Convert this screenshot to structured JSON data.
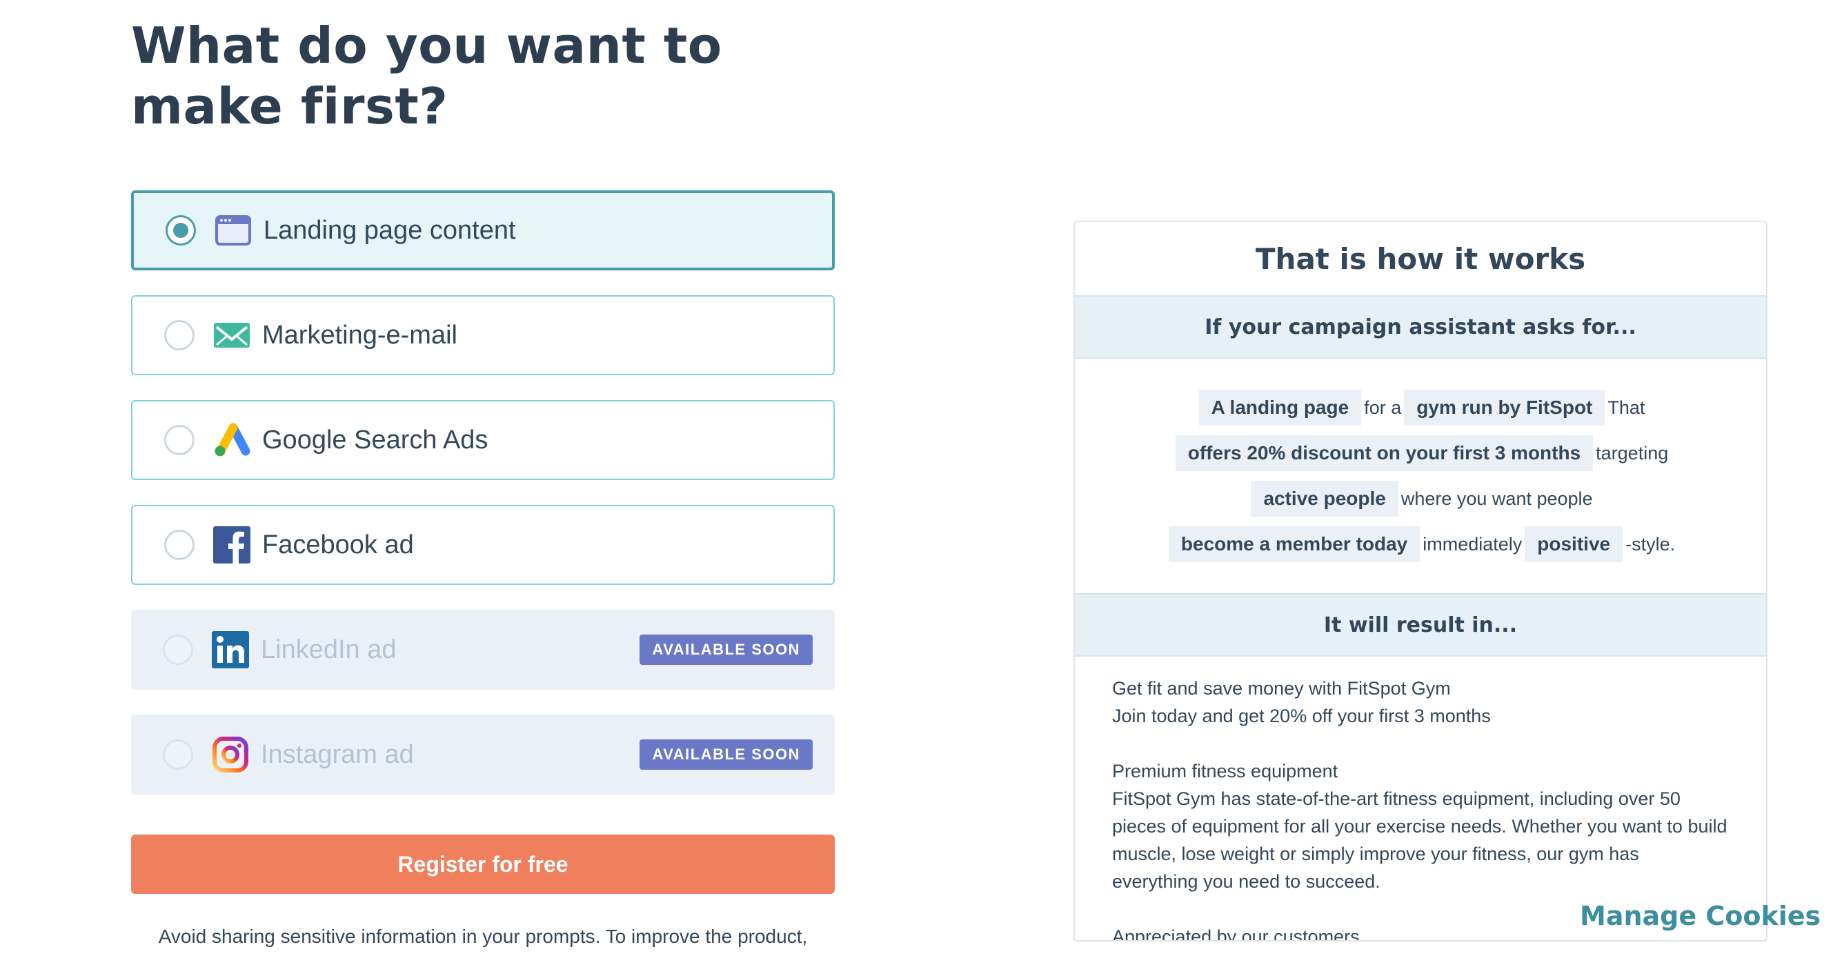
{
  "page": {
    "title": "What do you want to make first?"
  },
  "options": [
    {
      "label": "Landing page content",
      "icon": "browser-window-icon",
      "selected": true,
      "available": true
    },
    {
      "label": "Marketing-e-mail",
      "icon": "envelope-icon",
      "selected": false,
      "available": true
    },
    {
      "label": "Google Search Ads",
      "icon": "google-ads-icon",
      "selected": false,
      "available": true
    },
    {
      "label": "Facebook ad",
      "icon": "facebook-icon",
      "selected": false,
      "available": true
    },
    {
      "label": "LinkedIn ad",
      "icon": "linkedin-icon",
      "selected": false,
      "available": false,
      "badge": "AVAILABLE SOON"
    },
    {
      "label": "Instagram ad",
      "icon": "instagram-icon",
      "selected": false,
      "available": false,
      "badge": "AVAILABLE SOON"
    }
  ],
  "cta": {
    "label": "Register for free",
    "color": "#f07f5e"
  },
  "disclaimer": "Avoid sharing sensitive information in your prompts. To improve the product,",
  "how_it_works": {
    "title": "That is how it works",
    "asks_heading": "If your campaign assistant asks for...",
    "prompt": {
      "chip1": "A landing page",
      "text1": "for a",
      "chip2": "gym run by FitSpot",
      "text2": "That",
      "chip3": "offers 20% discount on your first 3 months",
      "text3": "targeting",
      "chip4": "active people",
      "text4": "where you want people",
      "chip5": "become a member today",
      "text5": "immediately",
      "chip6": "positive",
      "text6": "-style."
    },
    "result_heading": "It will result in...",
    "result": {
      "line1": "Get fit and save money with FitSpot Gym",
      "line2": "Join today and get 20% off your first 3 months",
      "line3": "Premium fitness equipment",
      "line4": "FitSpot Gym has state-of-the-art fitness equipment, including over 50 pieces of equipment for all your exercise needs. Whether you want to build muscle, lose weight or simply improve your fitness, our gym has everything you need to succeed.",
      "line5": "Appreciated by our customers"
    }
  },
  "cookies": {
    "label": "Manage Cookies"
  },
  "colors": {
    "selected_border": "#4a9bab",
    "option_border": "#7fd1de",
    "badge": "#6b78c8",
    "heading": "#2d3e50",
    "link": "#3c8ea0"
  }
}
